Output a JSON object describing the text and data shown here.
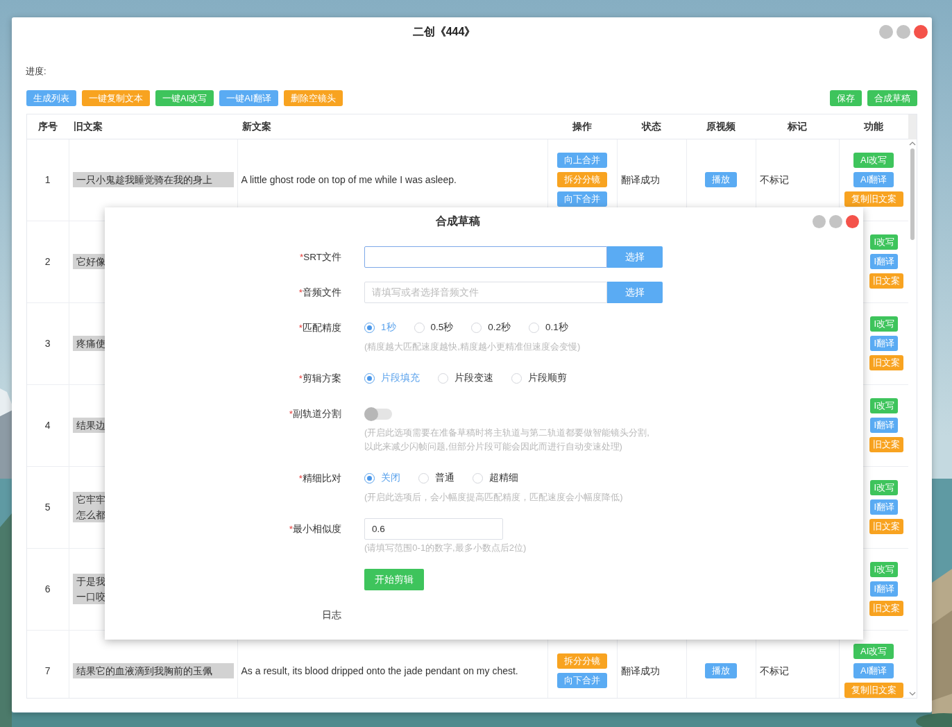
{
  "window": {
    "title": "二创《444》"
  },
  "progress": {
    "label": "进度:"
  },
  "toolbar": {
    "left": [
      {
        "label": "生成列表",
        "kind": "blue"
      },
      {
        "label": "一键复制文本",
        "kind": "orange"
      },
      {
        "label": "一键AI改写",
        "kind": "green"
      },
      {
        "label": "一键AI翻译",
        "kind": "blue"
      },
      {
        "label": "删除空镜头",
        "kind": "orange"
      }
    ],
    "right": [
      {
        "label": "保存",
        "kind": "green"
      },
      {
        "label": "合成草稿",
        "kind": "green"
      }
    ]
  },
  "table": {
    "columns": [
      "序号",
      "旧文案",
      "新文案",
      "操作",
      "状态",
      "原视频",
      "标记",
      "功能"
    ],
    "rows": [
      {
        "index": "1",
        "old_text": [
          "一只小鬼趁我睡觉骑在我的身上"
        ],
        "new_text": "A little ghost rode on top of me while I was asleep.",
        "operations": [
          {
            "label": "向上合并",
            "kind": "blue"
          },
          {
            "label": "拆分分镜",
            "kind": "orange"
          },
          {
            "label": "向下合并",
            "kind": "blue"
          }
        ],
        "status": "翻译成功",
        "video": "播放",
        "mark": "不标记",
        "functions": [
          {
            "label": "AI改写",
            "kind": "green"
          },
          {
            "label": "AI翻译",
            "kind": "blue"
          },
          {
            "label": "复制旧文案",
            "kind": "orange"
          }
        ]
      },
      {
        "index": "2",
        "old_text": [
          "它好像"
        ],
        "functions": [
          {
            "label": "I改写",
            "kind": "green"
          },
          {
            "label": "I翻译",
            "kind": "blue"
          },
          {
            "label": "旧文案",
            "kind": "orange"
          }
        ]
      },
      {
        "index": "3",
        "old_text": [
          "疼痛使"
        ],
        "functions": [
          {
            "label": "I改写",
            "kind": "green"
          },
          {
            "label": "I翻译",
            "kind": "blue"
          },
          {
            "label": "旧文案",
            "kind": "orange"
          }
        ]
      },
      {
        "index": "4",
        "old_text": [
          "结果边"
        ],
        "functions": [
          {
            "label": "I改写",
            "kind": "green"
          },
          {
            "label": "I翻译",
            "kind": "blue"
          },
          {
            "label": "旧文案",
            "kind": "orange"
          }
        ]
      },
      {
        "index": "5",
        "old_text": [
          "它牢牢",
          "怎么都"
        ],
        "functions": [
          {
            "label": "I改写",
            "kind": "green"
          },
          {
            "label": "I翻译",
            "kind": "blue"
          },
          {
            "label": "旧文案",
            "kind": "orange"
          }
        ]
      },
      {
        "index": "6",
        "old_text": [
          "于是我",
          "一口咬"
        ],
        "functions": [
          {
            "label": "I改写",
            "kind": "green"
          },
          {
            "label": "I翻译",
            "kind": "blue"
          },
          {
            "label": "旧文案",
            "kind": "orange"
          }
        ]
      },
      {
        "index": "7",
        "old_text": [
          "结果它的血液滴到我胸前的玉佩"
        ],
        "new_text": "As a result, its blood dripped onto the jade pendant on my chest.",
        "operations": [
          {
            "label": "拆分分镜",
            "kind": "orange"
          },
          {
            "label": "向下合并",
            "kind": "blue"
          }
        ],
        "status": "翻译成功",
        "video": "播放",
        "mark": "不标记",
        "functions": [
          {
            "label": "AI改写",
            "kind": "green"
          },
          {
            "label": "AI翻译",
            "kind": "blue"
          },
          {
            "label": "复制旧文案",
            "kind": "orange"
          }
        ]
      }
    ]
  },
  "dialog": {
    "title": "合成草稿",
    "fields": [
      {
        "kind": "file",
        "marker": "*",
        "label": "SRT文件",
        "focused": true,
        "button": "选择"
      },
      {
        "kind": "file",
        "marker": "*",
        "label": "音频文件",
        "focused": false,
        "placeholder": "请填写或者选择音频文件",
        "button": "选择"
      },
      {
        "kind": "radio",
        "marker": "*",
        "label": "匹配精度",
        "options": [
          {
            "label": "1秒",
            "selected": true
          },
          {
            "label": "0.5秒",
            "selected": false
          },
          {
            "label": "0.2秒",
            "selected": false
          },
          {
            "label": "0.1秒",
            "selected": false
          }
        ],
        "hint": [
          "(精度越大匹配速度越快,精度越小更精准但速度会变慢)"
        ]
      },
      {
        "kind": "radio",
        "marker": "*",
        "label": "剪辑方案",
        "options": [
          {
            "label": "片段填充",
            "selected": true
          },
          {
            "label": "片段变速",
            "selected": false
          },
          {
            "label": "片段顺剪",
            "selected": false
          }
        ]
      },
      {
        "kind": "switch",
        "marker": "*",
        "label": "副轨道分割",
        "on": false,
        "hint": [
          "(开启此选项需要在准备草稿时将主轨道与第二轨道都要做智能镜头分割,",
          "以此来减少闪帧问题,但部分片段可能会因此而进行自动变速处理)"
        ]
      },
      {
        "kind": "radio",
        "marker": "*",
        "label": "精细比对",
        "options": [
          {
            "label": "关闭",
            "selected": true
          },
          {
            "label": "普通",
            "selected": false
          },
          {
            "label": "超精细",
            "selected": false
          }
        ],
        "hint": [
          "(开启此选项后，会小幅度提高匹配精度，匹配速度会小幅度降低)"
        ]
      },
      {
        "kind": "text",
        "marker": "*",
        "label": "最小相似度",
        "value": "0.6",
        "hint": [
          "(请填写范围0-1的数字,最多小数点后2位)"
        ]
      },
      {
        "kind": "button",
        "label": "开始剪辑"
      },
      {
        "kind": "log",
        "label": "日志"
      }
    ]
  }
}
